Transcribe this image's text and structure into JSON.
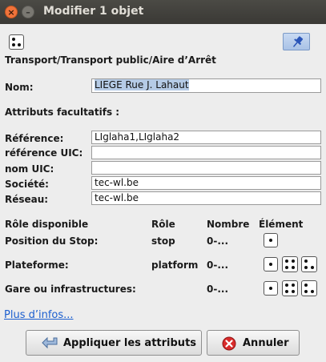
{
  "window": {
    "title": "Modifier 1 objet",
    "close_glyph": "×",
    "min_glyph": "–"
  },
  "preset": {
    "path": "Transport/Transport public/Aire d’Arrêt"
  },
  "name_field": {
    "label": "Nom:",
    "value": "LIEGE Rue J. Lahaut"
  },
  "optional": {
    "heading": "Attributs facultatifs :",
    "fields": [
      {
        "label": "Référence:",
        "value": "LIglaha1,LIglaha2"
      },
      {
        "label": "référence UIC:",
        "value": ""
      },
      {
        "label": "nom UIC:",
        "value": ""
      },
      {
        "label": "Société:",
        "value": "tec-wl.be"
      },
      {
        "label": "Réseau:",
        "value": "tec-wl.be"
      }
    ]
  },
  "roles": {
    "headers": {
      "available": "Rôle disponible",
      "role": "Rôle",
      "count": "Nombre",
      "element": "Élément"
    },
    "rows": [
      {
        "label": "Position du Stop:",
        "role": "stop",
        "count": "0-..."
      },
      {
        "label": "Plateforme:",
        "role": "platform",
        "count": "0-..."
      },
      {
        "label": "Gare ou infrastructures:",
        "role": "",
        "count": "0-..."
      }
    ]
  },
  "more_info": "Plus d’infos...",
  "buttons": {
    "apply": "Appliquer les attributs",
    "cancel": "Annuler"
  },
  "colors": {
    "accent": "#1c5fcf",
    "selection": "#b5cbe6",
    "cancel_icon": "#d92b2b"
  }
}
